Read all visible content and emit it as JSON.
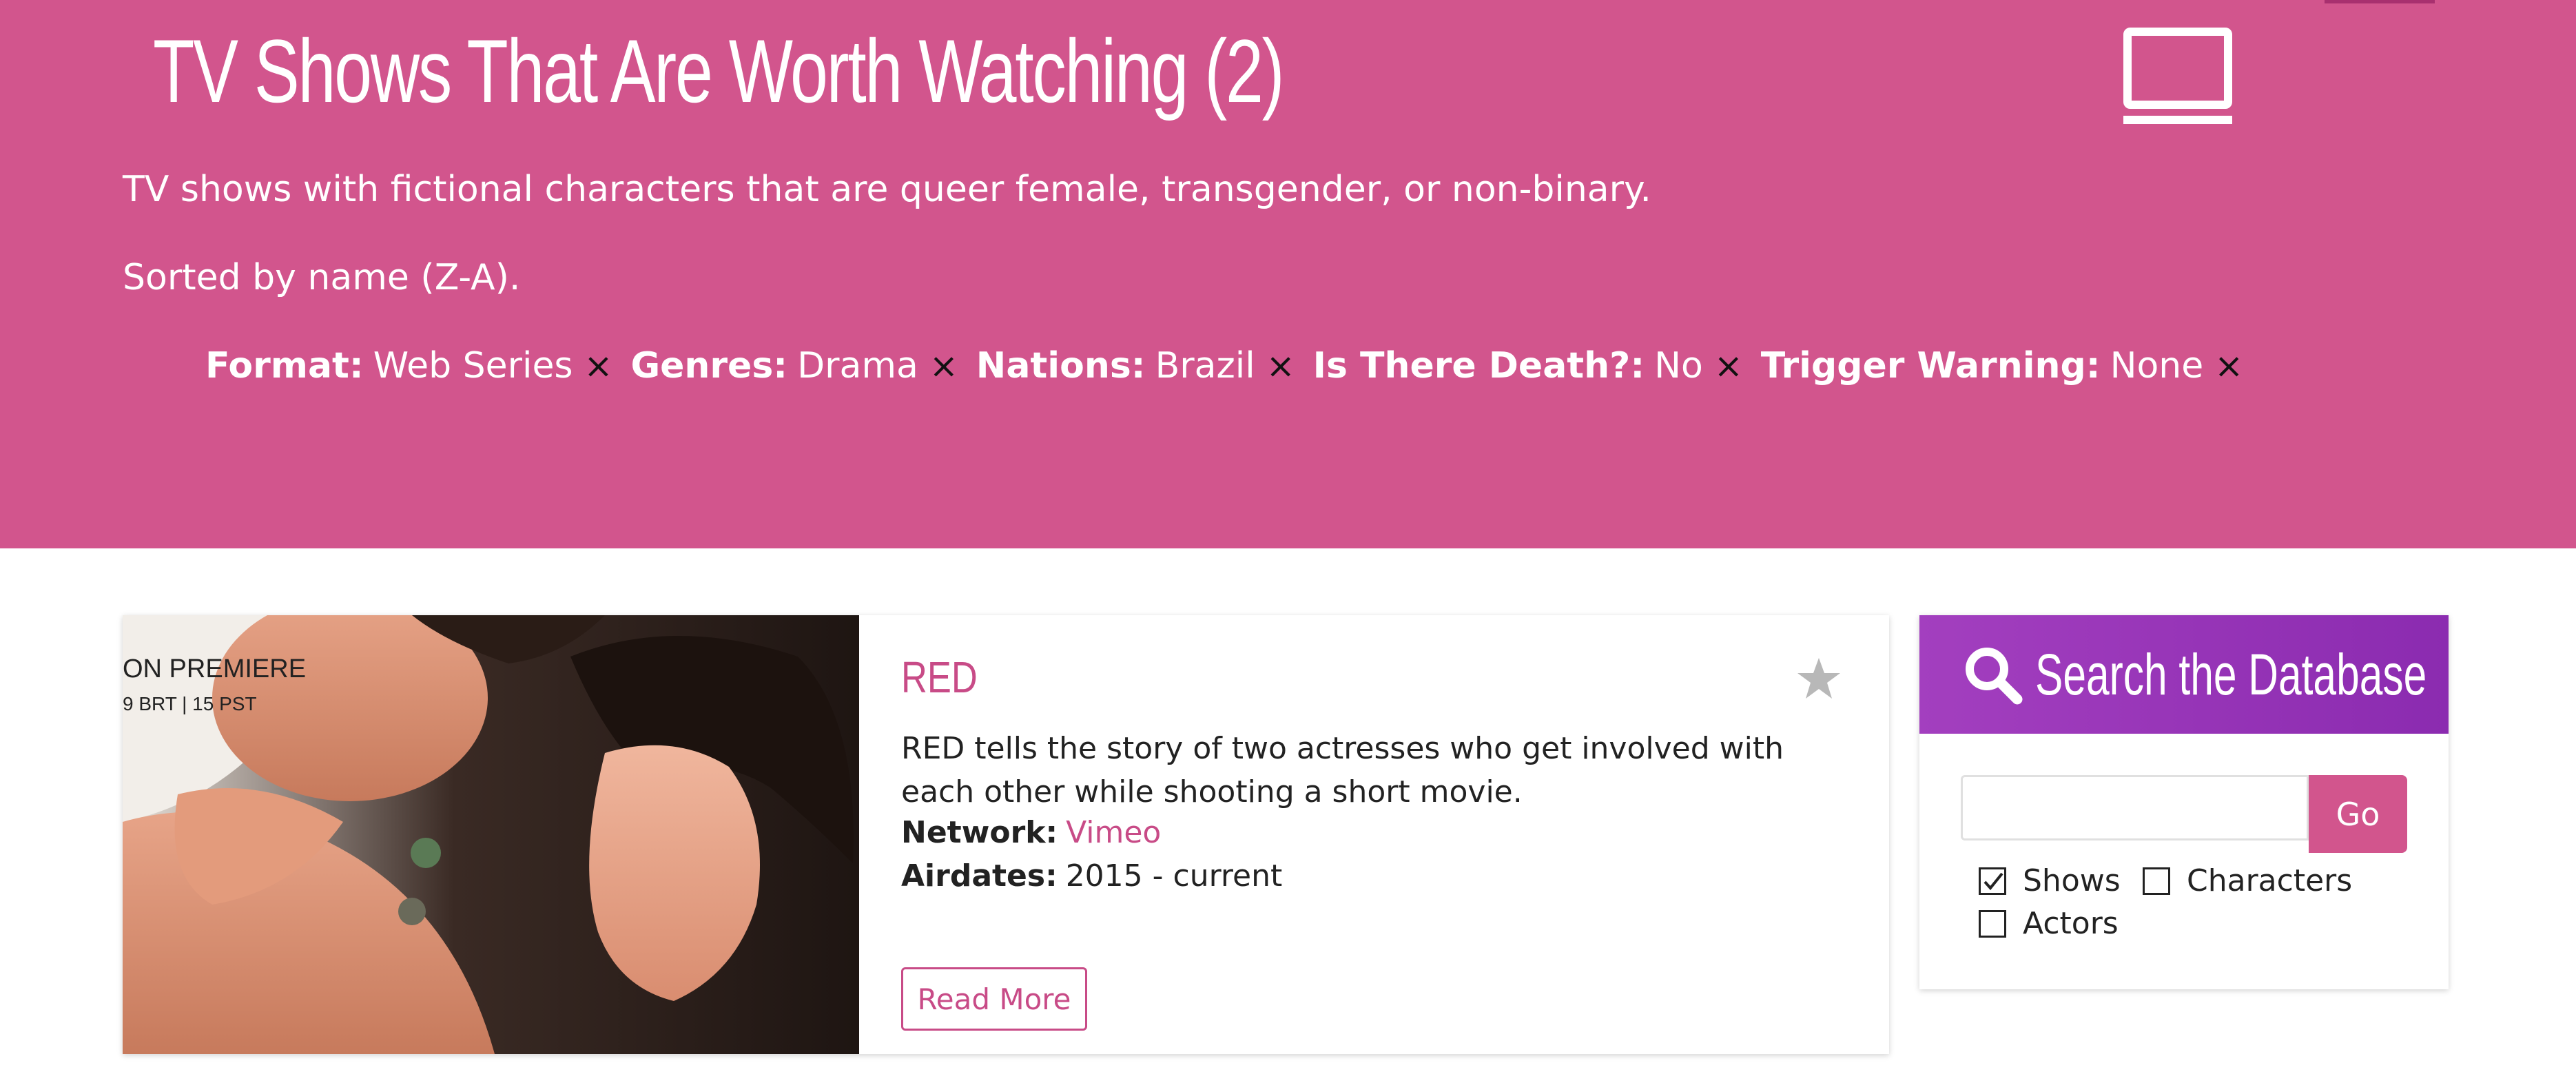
{
  "hero": {
    "title": "TV Shows That Are Worth Watching (2)",
    "description": "TV shows with fictional characters that are queer female, transgender, or non-binary.",
    "sort_text": "Sorted by name (Z-A).",
    "icon": "tv-icon",
    "background_color": "#d2558d",
    "filters": [
      {
        "label": "Format:",
        "value": "Web Series",
        "remove": "×"
      },
      {
        "label": "Genres:",
        "value": "Drama",
        "remove": "×"
      },
      {
        "label": "Nations:",
        "value": "Brazil",
        "remove": "×"
      },
      {
        "label": "Is There Death?:",
        "value": "No",
        "remove": "×"
      },
      {
        "label": "Trigger Warning:",
        "value": "None",
        "remove": "×"
      }
    ]
  },
  "show": {
    "title": "RED",
    "description": "RED tells the story of two actresses who get involved with each other while shooting a short movie.",
    "network_label": "Network:",
    "network": "Vimeo",
    "airdates_label": "Airdates:",
    "airdates": "2015 - current",
    "read_more": "Read More",
    "favorite_icon": "star-icon",
    "accent_color": "#c84b87",
    "image_overlay_text": [
      "ON PREMIERE",
      "9 BRT | 15 PST"
    ]
  },
  "search": {
    "title": "Search the Database",
    "icon": "search-icon",
    "input_value": "",
    "go_label": "Go",
    "header_color": "#9a36b8",
    "options": [
      {
        "label": "Shows",
        "checked": true
      },
      {
        "label": "Characters",
        "checked": false
      },
      {
        "label": "Actors",
        "checked": false
      }
    ]
  }
}
